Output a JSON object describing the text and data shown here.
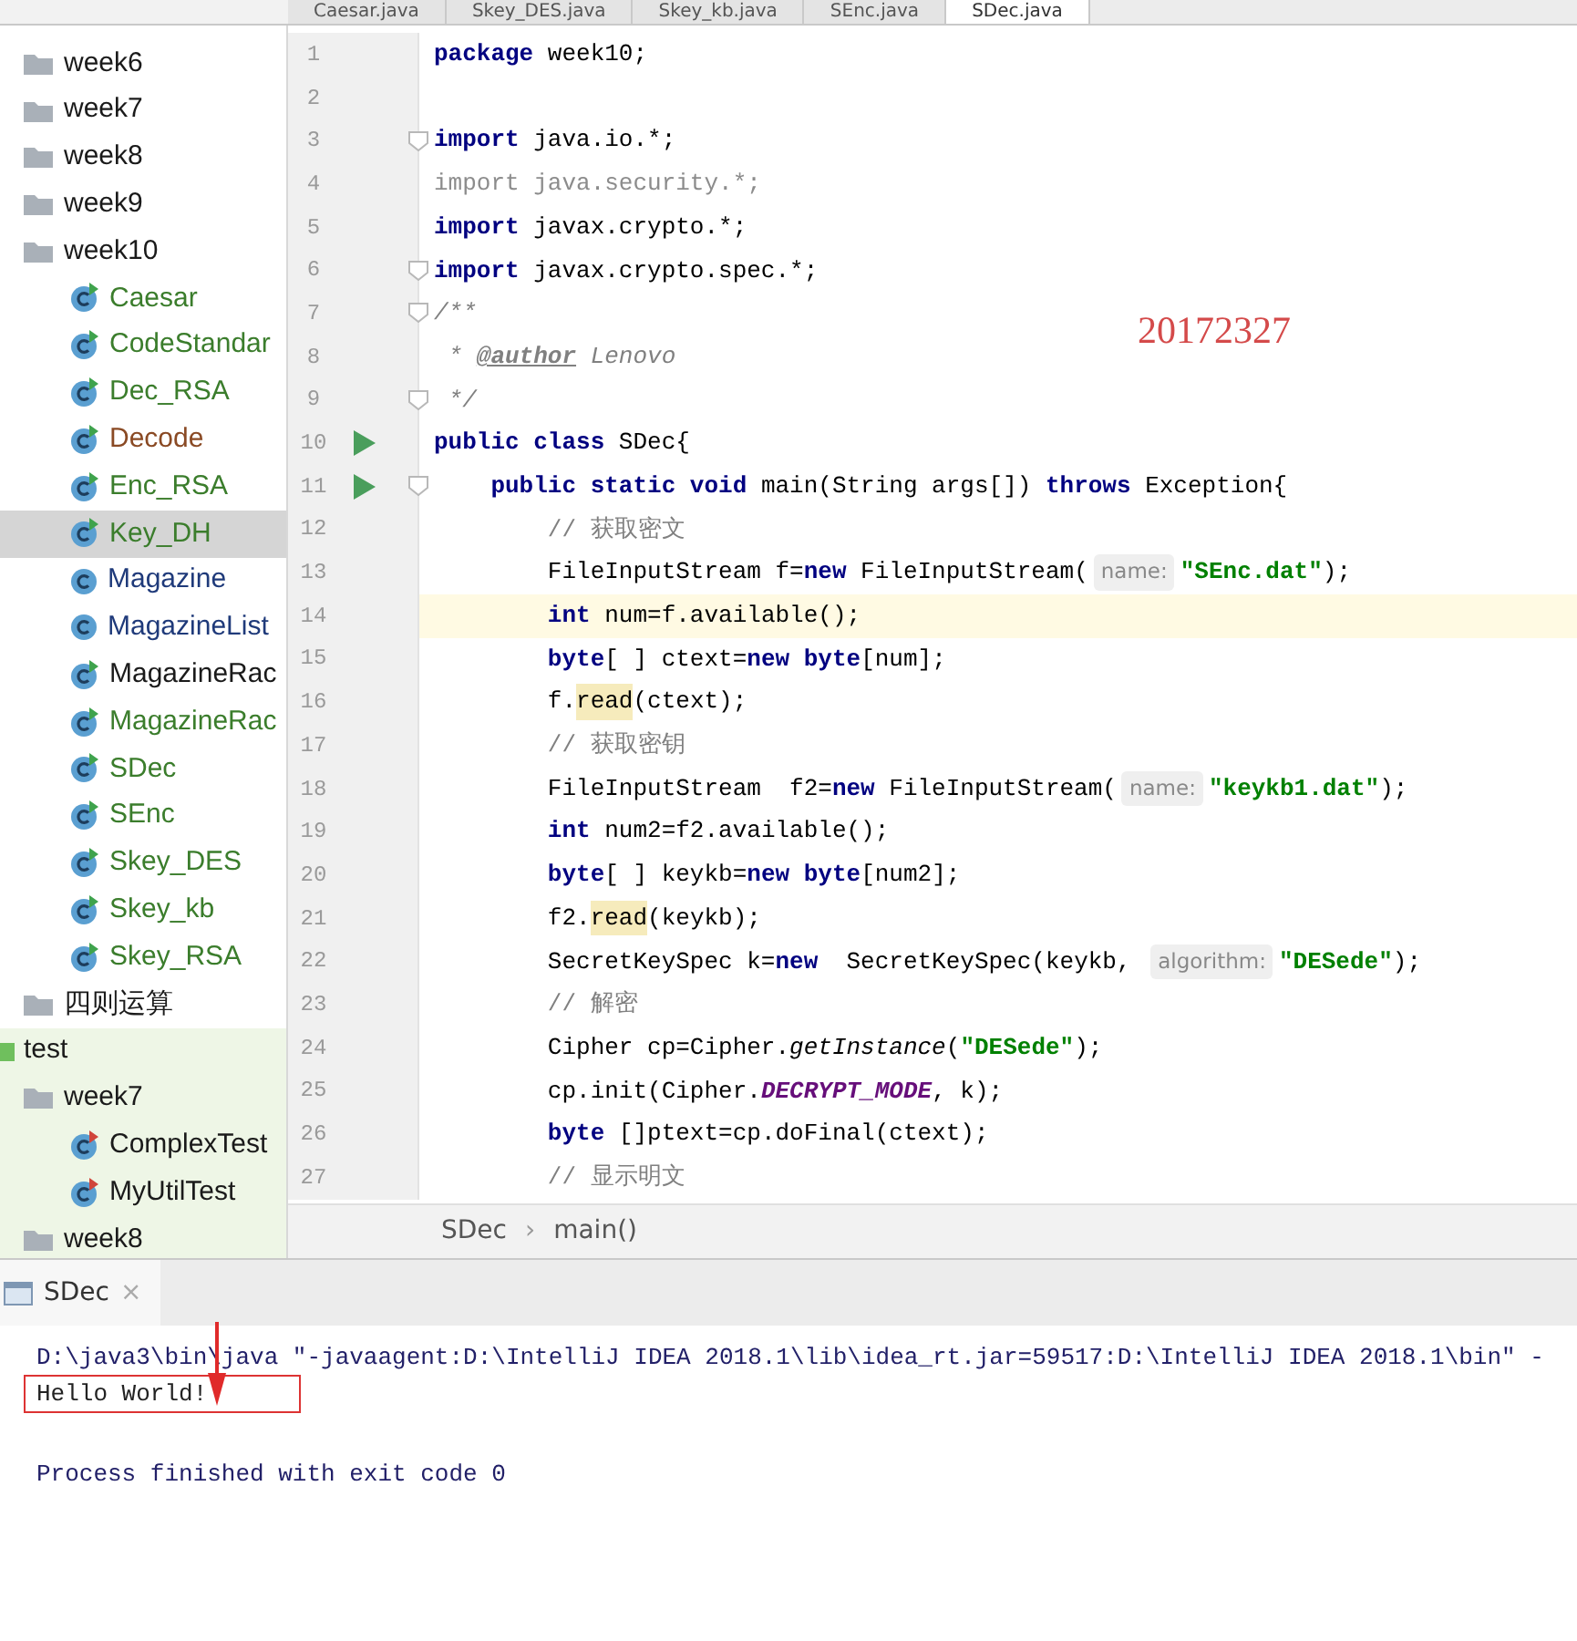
{
  "editor_tabs": [
    {
      "label": "Caesar.java",
      "selected": false
    },
    {
      "label": "Skey_DES.java",
      "selected": false
    },
    {
      "label": "Skey_kb.java",
      "selected": false
    },
    {
      "label": "SEnc.java",
      "selected": false
    },
    {
      "label": "SDec.java",
      "selected": true
    }
  ],
  "project_tree": [
    {
      "label": "week6",
      "kind": "folder",
      "color": "#1a1a1a",
      "selected": false
    },
    {
      "label": "week7",
      "kind": "folder",
      "color": "#1a1a1a",
      "selected": false
    },
    {
      "label": "week8",
      "kind": "folder",
      "color": "#1a1a1a",
      "selected": false
    },
    {
      "label": "week9",
      "kind": "folder",
      "color": "#1a1a1a",
      "selected": false
    },
    {
      "label": "week10",
      "kind": "folder",
      "color": "#1a1a1a",
      "selected": false,
      "children": [
        {
          "label": "Caesar",
          "kind": "runnable",
          "color": "#3b7d2c",
          "selected": false
        },
        {
          "label": "CodeStandar",
          "kind": "runnable",
          "color": "#3b7d2c",
          "selected": false
        },
        {
          "label": "Dec_RSA",
          "kind": "runnable",
          "color": "#3b7d2c",
          "selected": false
        },
        {
          "label": "Decode",
          "kind": "runnable",
          "color": "#8a4a24",
          "selected": false
        },
        {
          "label": "Enc_RSA",
          "kind": "runnable",
          "color": "#3b7d2c",
          "selected": false
        },
        {
          "label": "Key_DH",
          "kind": "runnable",
          "color": "#3b7d2c",
          "selected": true
        },
        {
          "label": "Magazine",
          "kind": "class",
          "color": "#1f3a7a",
          "selected": false
        },
        {
          "label": "MagazineList",
          "kind": "class",
          "color": "#1f3a7a",
          "selected": false
        },
        {
          "label": "MagazineRac",
          "kind": "runnable",
          "color": "#1a1a1a",
          "selected": false
        },
        {
          "label": "MagazineRac",
          "kind": "runnable",
          "color": "#3b7d2c",
          "selected": false
        },
        {
          "label": "SDec",
          "kind": "runnable",
          "color": "#3b7d2c",
          "selected": false
        },
        {
          "label": "SEnc",
          "kind": "runnable",
          "color": "#3b7d2c",
          "selected": false
        },
        {
          "label": "Skey_DES",
          "kind": "runnable",
          "color": "#3b7d2c",
          "selected": false
        },
        {
          "label": "Skey_kb",
          "kind": "runnable",
          "color": "#3b7d2c",
          "selected": false
        },
        {
          "label": "Skey_RSA",
          "kind": "runnable",
          "color": "#3b7d2c",
          "selected": false
        }
      ]
    },
    {
      "label": "四则运算",
      "kind": "folder",
      "color": "#1a1a1a",
      "selected": false
    },
    {
      "label": "test",
      "kind": "test-root",
      "color": "#1a1a1a",
      "selected": false,
      "children": [
        {
          "label": "week7",
          "kind": "folder",
          "color": "#1a1a1a",
          "selected": false,
          "children": [
            {
              "label": "ComplexTest",
              "kind": "test",
              "color": "#1a1a1a",
              "selected": false
            },
            {
              "label": "MyUtilTest",
              "kind": "test",
              "color": "#1a1a1a",
              "selected": false
            }
          ]
        },
        {
          "label": "week8",
          "kind": "folder",
          "color": "#1a1a1a",
          "selected": false
        }
      ]
    }
  ],
  "code_lines": [
    {
      "number": "1",
      "run": false,
      "fold": false,
      "current": false,
      "tokens": [
        {
          "kind": "kw",
          "text": "package"
        },
        {
          "kind": "plain",
          "text": " week10;"
        }
      ]
    },
    {
      "number": "2",
      "run": false,
      "fold": false,
      "current": false
    },
    {
      "number": "3",
      "run": false,
      "fold": true,
      "current": false,
      "tokens": [
        {
          "kind": "kw",
          "text": "import"
        },
        {
          "kind": "plain",
          "text": " java.io.*;"
        }
      ]
    },
    {
      "number": "4",
      "run": false,
      "fold": false,
      "current": false,
      "tokens": [
        {
          "kind": "unused",
          "text": "import java.security.*;"
        }
      ]
    },
    {
      "number": "5",
      "run": false,
      "fold": false,
      "current": false,
      "tokens": [
        {
          "kind": "kw",
          "text": "import"
        },
        {
          "kind": "plain",
          "text": " javax.crypto.*;"
        }
      ]
    },
    {
      "number": "6",
      "run": false,
      "fold": true,
      "current": false,
      "tokens": [
        {
          "kind": "kw",
          "text": "import"
        },
        {
          "kind": "plain",
          "text": " javax.crypto.spec.*;"
        }
      ]
    },
    {
      "number": "7",
      "run": false,
      "fold": true,
      "current": false,
      "tokens": [
        {
          "kind": "doc",
          "text": "/**"
        }
      ]
    },
    {
      "number": "8",
      "run": false,
      "fold": false,
      "current": false,
      "tokens": [
        {
          "kind": "doc",
          "text": " * "
        },
        {
          "kind": "doctag",
          "text": "@author"
        },
        {
          "kind": "doc",
          "text": " Lenovo"
        }
      ]
    },
    {
      "number": "9",
      "run": false,
      "fold": true,
      "current": false,
      "tokens": [
        {
          "kind": "doc",
          "text": " */"
        }
      ]
    },
    {
      "number": "10",
      "run": true,
      "fold": false,
      "current": false,
      "tokens": [
        {
          "kind": "kw",
          "text": "public class"
        },
        {
          "kind": "plain",
          "text": " SDec{"
        }
      ]
    },
    {
      "number": "11",
      "run": true,
      "fold": true,
      "current": false,
      "tokens": [
        {
          "kind": "kw",
          "text": "    public static void"
        },
        {
          "kind": "plain",
          "text": " main(String args[]) "
        },
        {
          "kind": "kw",
          "text": "throws"
        },
        {
          "kind": "plain",
          "text": " Exception{"
        }
      ]
    },
    {
      "number": "12",
      "run": false,
      "fold": false,
      "current": false,
      "tokens": [
        {
          "kind": "comment",
          "text": "        // 获取密文"
        }
      ]
    },
    {
      "number": "13",
      "run": false,
      "fold": false,
      "current": false,
      "tokens": [
        {
          "kind": "plain",
          "text": "        FileInputStream f="
        },
        {
          "kind": "kw",
          "text": "new"
        },
        {
          "kind": "plain",
          "text": " FileInputStream("
        },
        {
          "kind": "hint",
          "text": "name:"
        },
        {
          "kind": "str",
          "text": "\"SEnc.dat\""
        },
        {
          "kind": "plain",
          "text": ");"
        }
      ]
    },
    {
      "number": "14",
      "run": false,
      "fold": false,
      "current": true,
      "tokens": [
        {
          "kind": "kw",
          "text": "        int"
        },
        {
          "kind": "plain",
          "text": " num=f.available();"
        }
      ]
    },
    {
      "number": "15",
      "run": false,
      "fold": false,
      "current": false,
      "tokens": [
        {
          "kind": "kw",
          "text": "        byte"
        },
        {
          "kind": "plain",
          "text": "[ ] ctext="
        },
        {
          "kind": "kw",
          "text": "new byte"
        },
        {
          "kind": "plain",
          "text": "[num];"
        }
      ]
    },
    {
      "number": "16",
      "run": false,
      "fold": false,
      "current": false,
      "tokens": [
        {
          "kind": "plain",
          "text": "        f."
        },
        {
          "kind": "usage",
          "text": "read"
        },
        {
          "kind": "plain",
          "text": "(ctext);"
        }
      ]
    },
    {
      "number": "17",
      "run": false,
      "fold": false,
      "current": false,
      "tokens": [
        {
          "kind": "comment",
          "text": "        // 获取密钥"
        }
      ]
    },
    {
      "number": "18",
      "run": false,
      "fold": false,
      "current": false,
      "tokens": [
        {
          "kind": "plain",
          "text": "        FileInputStream  f2="
        },
        {
          "kind": "kw",
          "text": "new"
        },
        {
          "kind": "plain",
          "text": " FileInputStream("
        },
        {
          "kind": "hint",
          "text": "name:"
        },
        {
          "kind": "str",
          "text": "\"keykb1.dat\""
        },
        {
          "kind": "plain",
          "text": ");"
        }
      ]
    },
    {
      "number": "19",
      "run": false,
      "fold": false,
      "current": false,
      "tokens": [
        {
          "kind": "kw",
          "text": "        int"
        },
        {
          "kind": "plain",
          "text": " num2=f2.available();"
        }
      ]
    },
    {
      "number": "20",
      "run": false,
      "fold": false,
      "current": false,
      "tokens": [
        {
          "kind": "kw",
          "text": "        byte"
        },
        {
          "kind": "plain",
          "text": "[ ] keykb="
        },
        {
          "kind": "kw",
          "text": "new byte"
        },
        {
          "kind": "plain",
          "text": "[num2];"
        }
      ]
    },
    {
      "number": "21",
      "run": false,
      "fold": false,
      "current": false,
      "tokens": [
        {
          "kind": "plain",
          "text": "        f2."
        },
        {
          "kind": "usage",
          "text": "read"
        },
        {
          "kind": "plain",
          "text": "(keykb);"
        }
      ]
    },
    {
      "number": "22",
      "run": false,
      "fold": false,
      "current": false,
      "tokens": [
        {
          "kind": "plain",
          "text": "        SecretKeySpec k="
        },
        {
          "kind": "kw",
          "text": "new"
        },
        {
          "kind": "plain",
          "text": "  SecretKeySpec(keykb, "
        },
        {
          "kind": "hint",
          "text": "algorithm:"
        },
        {
          "kind": "str",
          "text": "\"DESede\""
        },
        {
          "kind": "plain",
          "text": ");"
        }
      ]
    },
    {
      "number": "23",
      "run": false,
      "fold": false,
      "current": false,
      "tokens": [
        {
          "kind": "comment",
          "text": "        // 解密"
        }
      ]
    },
    {
      "number": "24",
      "run": false,
      "fold": false,
      "current": false,
      "tokens": [
        {
          "kind": "plain",
          "text": "        Cipher cp=Cipher."
        },
        {
          "kind": "static",
          "text": "getInstance"
        },
        {
          "kind": "plain",
          "text": "("
        },
        {
          "kind": "str",
          "text": "\"DESede\""
        },
        {
          "kind": "plain",
          "text": ");"
        }
      ]
    },
    {
      "number": "25",
      "run": false,
      "fold": false,
      "current": false,
      "tokens": [
        {
          "kind": "plain",
          "text": "        cp.init(Cipher."
        },
        {
          "kind": "const",
          "text": "DECRYPT_MODE"
        },
        {
          "kind": "plain",
          "text": ", k);"
        }
      ]
    },
    {
      "number": "26",
      "run": false,
      "fold": false,
      "current": false,
      "tokens": [
        {
          "kind": "kw",
          "text": "        byte"
        },
        {
          "kind": "plain",
          "text": " []ptext=cp.doFinal(ctext);"
        }
      ]
    },
    {
      "number": "27",
      "run": false,
      "fold": false,
      "current": false,
      "tokens": [
        {
          "kind": "comment",
          "text": "        // 显示明文"
        }
      ]
    }
  ],
  "annotation_text": "20172327",
  "breadcrumbs": [
    "SDec",
    "main()"
  ],
  "breadcrumb_separator": "›",
  "run_panel": {
    "tab": {
      "label": "SDec",
      "close": "×"
    },
    "console_lines": [
      {
        "kind": "command",
        "text": "D:\\java3\\bin\\java \"-javaagent:D:\\IntelliJ IDEA 2018.1\\lib\\idea_rt.jar=59517:D:\\IntelliJ IDEA 2018.1\\bin\" -",
        "boxed": false
      },
      {
        "kind": "output",
        "text": "Hello World!",
        "boxed": true
      },
      {
        "kind": "exit",
        "text": "Process finished with exit code 0",
        "boxed": false
      }
    ]
  }
}
